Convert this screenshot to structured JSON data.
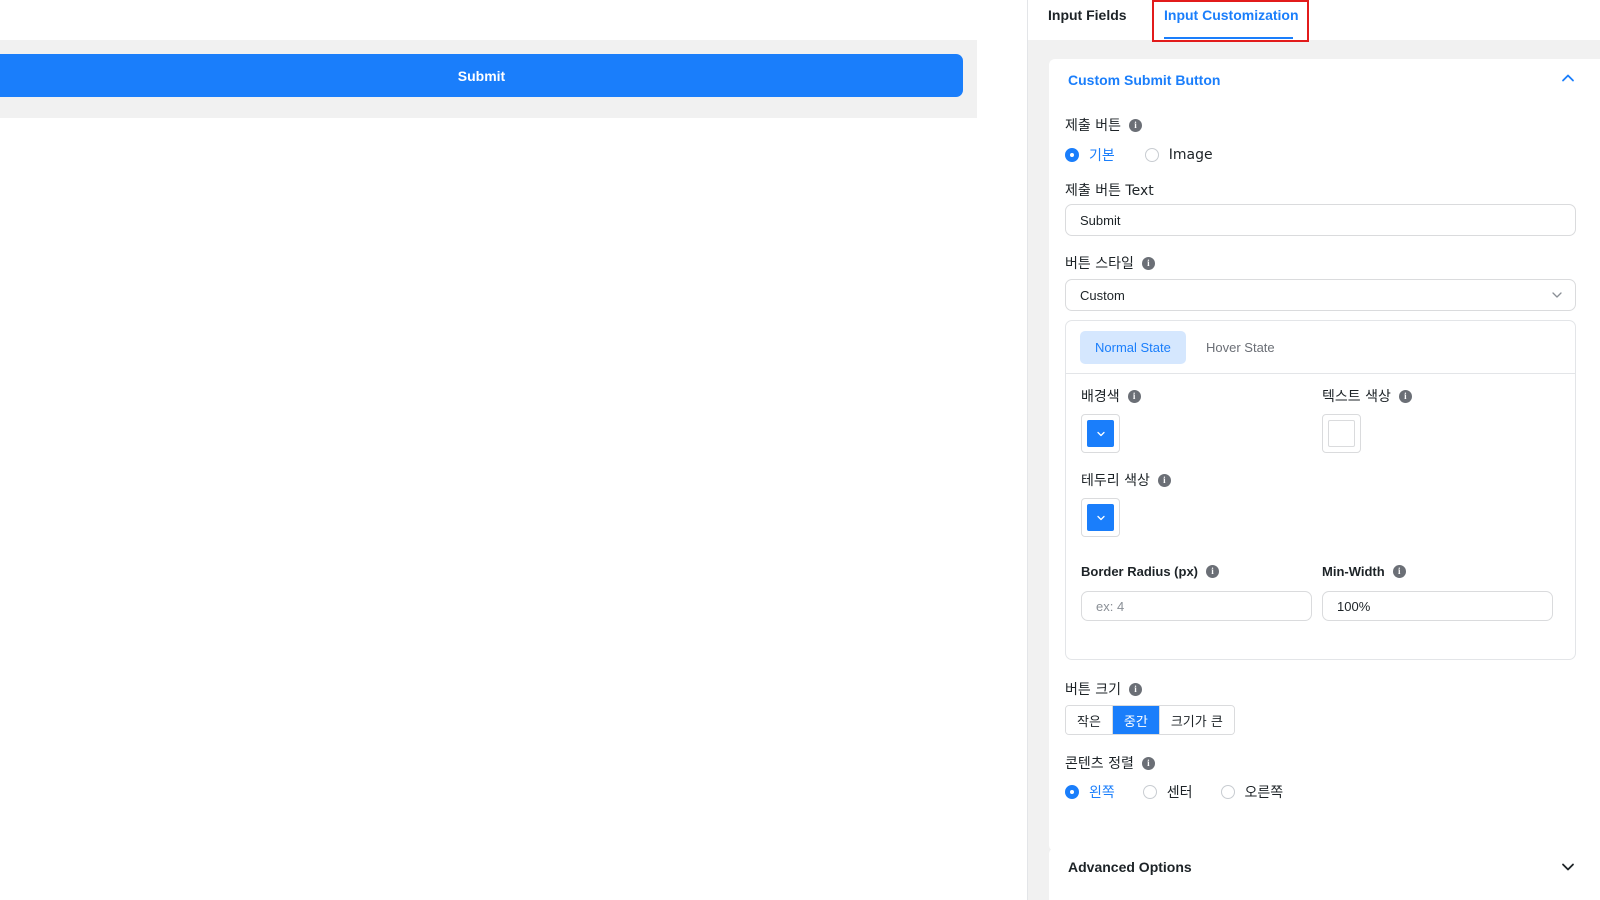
{
  "preview": {
    "submit_label": "Submit"
  },
  "tabs": [
    {
      "label": "Input Fields",
      "active": false
    },
    {
      "label": "Input Customization",
      "active": true
    }
  ],
  "panel": {
    "title": "Custom Submit Button",
    "submit_button": {
      "label": "제출 버튼",
      "options": [
        {
          "label": "기본",
          "selected": true
        },
        {
          "label": "Image",
          "selected": false
        }
      ]
    },
    "submit_text": {
      "label": "제출 버튼 Text",
      "value": "Submit"
    },
    "button_style": {
      "label": "버튼 스타일",
      "value": "Custom"
    },
    "state_tabs": [
      {
        "label": "Normal State",
        "active": true
      },
      {
        "label": "Hover State",
        "active": false
      }
    ],
    "bg_color": {
      "label": "배경색",
      "color": "#1a7efb"
    },
    "text_color": {
      "label": "텍스트 색상",
      "color": "#ffffff"
    },
    "border_color": {
      "label": "테두리 색상",
      "color": "#1a7efb"
    },
    "border_radius": {
      "label": "Border Radius (px)",
      "placeholder": "ex: 4"
    },
    "min_width": {
      "label": "Min-Width",
      "value": "100%"
    },
    "button_size": {
      "label": "버튼 크기",
      "options": [
        {
          "label": "작은",
          "active": false
        },
        {
          "label": "중간",
          "active": true
        },
        {
          "label": "크기가 큰",
          "active": false
        }
      ]
    },
    "alignment": {
      "label": "콘텐츠 정렬",
      "options": [
        {
          "label": "왼쪽",
          "selected": true
        },
        {
          "label": "센터",
          "selected": false
        },
        {
          "label": "오른쪽",
          "selected": false
        }
      ]
    }
  },
  "advanced": {
    "title": "Advanced Options"
  },
  "colors": {
    "accent": "#1a7efb",
    "highlight": "#e21b1b"
  }
}
